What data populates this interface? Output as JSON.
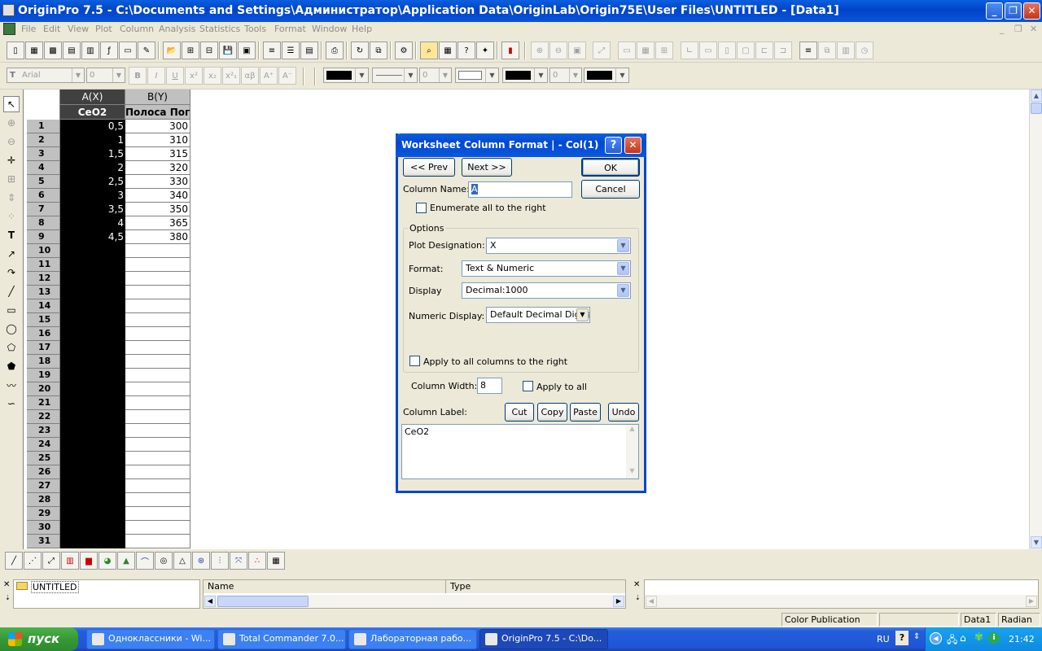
{
  "window": {
    "title": "OriginPro 7.5 - C:\\Documents and Settings\\Администратор\\Application Data\\OriginLab\\Origin75E\\User Files\\UNTITLED - [Data1]"
  },
  "menu": [
    "File",
    "Edit",
    "View",
    "Plot",
    "Column",
    "Analysis",
    "Statistics",
    "Tools",
    "Format",
    "Window",
    "Help"
  ],
  "format_toolbar": {
    "font": "Arial",
    "size": "0",
    "bold": "B",
    "italic": "I",
    "underline": "U",
    "superscript": "x²",
    "subscript": "x₂",
    "supsub": "x²₁",
    "greek": "αβ",
    "grow": "A⁺",
    "shrink": "A⁻",
    "line_width": "0",
    "pattern_width": "0"
  },
  "worksheet": {
    "columns": [
      {
        "name": "A(X)",
        "label": "CeO2"
      },
      {
        "name": "B(Y)",
        "label": "Полоса Погл"
      }
    ],
    "rows": [
      {
        "n": "1",
        "a": "0,5",
        "b": "300"
      },
      {
        "n": "2",
        "a": "1",
        "b": "310"
      },
      {
        "n": "3",
        "a": "1,5",
        "b": "315"
      },
      {
        "n": "4",
        "a": "2",
        "b": "320"
      },
      {
        "n": "5",
        "a": "2,5",
        "b": "330"
      },
      {
        "n": "6",
        "a": "3",
        "b": "340"
      },
      {
        "n": "7",
        "a": "3,5",
        "b": "350"
      },
      {
        "n": "8",
        "a": "4",
        "b": "365"
      },
      {
        "n": "9",
        "a": "4,5",
        "b": "380"
      },
      {
        "n": "10",
        "a": "",
        "b": ""
      },
      {
        "n": "11",
        "a": "",
        "b": ""
      },
      {
        "n": "12",
        "a": "",
        "b": ""
      },
      {
        "n": "13",
        "a": "",
        "b": ""
      },
      {
        "n": "14",
        "a": "",
        "b": ""
      },
      {
        "n": "15",
        "a": "",
        "b": ""
      },
      {
        "n": "16",
        "a": "",
        "b": ""
      },
      {
        "n": "17",
        "a": "",
        "b": ""
      },
      {
        "n": "18",
        "a": "",
        "b": ""
      },
      {
        "n": "19",
        "a": "",
        "b": ""
      },
      {
        "n": "20",
        "a": "",
        "b": ""
      },
      {
        "n": "21",
        "a": "",
        "b": ""
      },
      {
        "n": "22",
        "a": "",
        "b": ""
      },
      {
        "n": "23",
        "a": "",
        "b": ""
      },
      {
        "n": "24",
        "a": "",
        "b": ""
      },
      {
        "n": "25",
        "a": "",
        "b": ""
      },
      {
        "n": "26",
        "a": "",
        "b": ""
      },
      {
        "n": "27",
        "a": "",
        "b": ""
      },
      {
        "n": "28",
        "a": "",
        "b": ""
      },
      {
        "n": "29",
        "a": "",
        "b": ""
      },
      {
        "n": "30",
        "a": "",
        "b": ""
      },
      {
        "n": "31",
        "a": "",
        "b": ""
      }
    ]
  },
  "dialog": {
    "title": "Worksheet Column Format |  - Col(1)",
    "help": "?",
    "prev": "<< Prev",
    "next": "Next >>",
    "ok": "OK",
    "cancel": "Cancel",
    "column_name_label": "Column Name:",
    "column_name_value": "A",
    "enumerate_label": "Enumerate all to the right",
    "options_label": "Options",
    "plot_designation_label": "Plot Designation:",
    "plot_designation_value": "X",
    "format_label": "Format:",
    "format_value": "Text & Numeric",
    "display_label": "Display",
    "display_value": "Decimal:1000",
    "numeric_display_label": "Numeric Display:",
    "numeric_display_value": "Default Decimal Digits",
    "apply_all_right_label": "Apply to all columns to the right",
    "column_width_label": "Column Width:",
    "column_width_value": "8",
    "apply_all_label": "Apply to all",
    "column_label_label": "Column Label:",
    "cut": "Cut",
    "copy": "Copy",
    "paste": "Paste",
    "undo": "Undo",
    "column_label_value": "CeO2"
  },
  "explorer": {
    "folder": "UNTITLED",
    "col_name": "Name",
    "col_type": "Type"
  },
  "status": {
    "mode": "Color Publication",
    "window": "Data1",
    "angle": "Radian"
  },
  "taskbar": {
    "start": "пуск",
    "tasks": [
      "Одноклассники - Wi...",
      "Total Commander 7.0...",
      "Лабораторная рабо...",
      "OriginPro 7.5 - C:\\Do..."
    ],
    "lang": "RU",
    "clock": "21:42"
  }
}
